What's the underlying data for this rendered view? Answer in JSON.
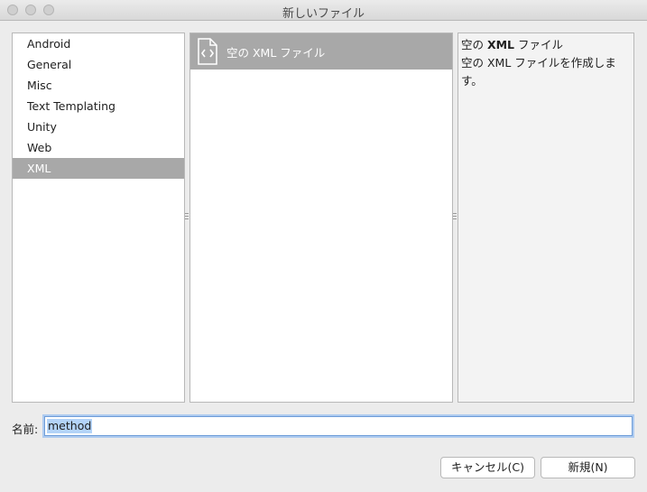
{
  "window": {
    "title": "新しいファイル"
  },
  "categories": [
    {
      "label": "Android",
      "selected": false
    },
    {
      "label": "General",
      "selected": false
    },
    {
      "label": "Misc",
      "selected": false
    },
    {
      "label": "Text Templating",
      "selected": false
    },
    {
      "label": "Unity",
      "selected": false
    },
    {
      "label": "Web",
      "selected": false
    },
    {
      "label": "XML",
      "selected": true
    }
  ],
  "templates": [
    {
      "label": "空の XML ファイル",
      "icon": "xml-file-icon",
      "selected": true
    }
  ],
  "description": {
    "title_prefix": "空の ",
    "title_bold": "XML",
    "title_suffix": " ファイル",
    "text": "空の XML ファイルを作成します。"
  },
  "name_field": {
    "label": "名前:",
    "value": "method"
  },
  "buttons": {
    "cancel": "キャンセル(C)",
    "new": "新規(N)"
  },
  "colors": {
    "selection": "#a8a8a8",
    "focus_ring": "#6d9cd8",
    "text_selection": "#b3d3f8"
  }
}
